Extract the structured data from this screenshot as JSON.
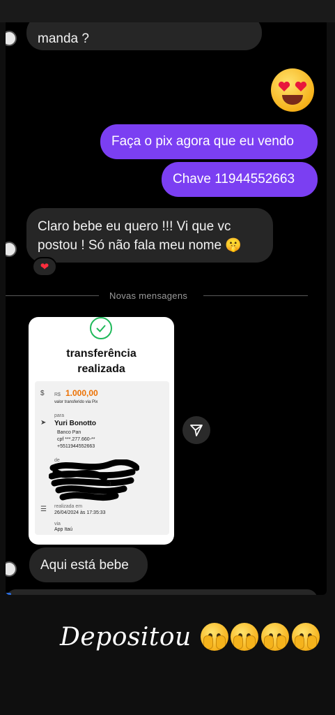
{
  "chat": {
    "msg_top_partial": "manda ?",
    "msg_out_1": "Faça o pix agora que eu vendo",
    "msg_out_2": "Chave 11944552663",
    "msg_in_1_line1": "Claro bebe eu quero !!! Vi que vc",
    "msg_in_1_line2": "postou ! Só não fala meu nome 🤫",
    "reaction_emoji": "❤",
    "divider_label": "Novas mensagens",
    "msg_in_2": "Aqui está bebe",
    "big_emoji": "heart-eyes-emoji",
    "share_icon": "send-icon"
  },
  "receipt": {
    "title_line1": "transferência",
    "title_line2": "realizada",
    "currency": "R$",
    "amount": "1.000,00",
    "amount_caption": "valor transferido via Pix",
    "to_label": "para",
    "to_name": "Yuri Bonotto",
    "to_bank": "Banco Pan",
    "to_cpf": "cpf ***.277.660-**",
    "to_key": "+5511944552663",
    "from_label": "de",
    "from_partial": "-1",
    "date_label": "realizada em",
    "date_value": "26/04/2024 às 17:35:33",
    "via_label": "via",
    "via_value": "App Itaú"
  },
  "caption": {
    "text": "Depositou",
    "emoji": "face-with-open-eyes-and-hand-over-mouth",
    "emoji_count": 4
  },
  "colors": {
    "outgoing_bubble": "#7b3ff2",
    "incoming_bubble": "#262626",
    "amount_orange": "#ec7000",
    "check_green": "#1fb95a"
  }
}
